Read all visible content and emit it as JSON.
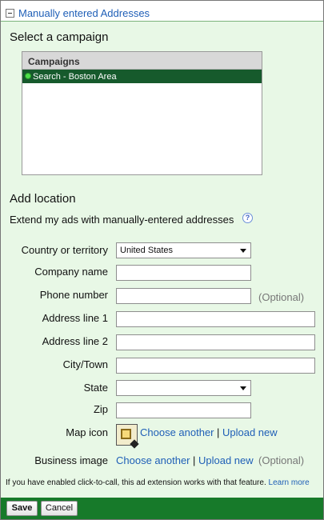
{
  "header": {
    "title": "Manually entered Addresses"
  },
  "campaign_section": {
    "heading": "Select a campaign",
    "list_header": "Campaigns",
    "items": [
      {
        "label": "Search - Boston Area",
        "status_color": "#4ee04a",
        "selected": true
      }
    ]
  },
  "location_section": {
    "heading": "Add location",
    "subtitle": "Extend my ads with manually-entered addresses",
    "help_glyph": "?"
  },
  "form": {
    "country": {
      "label": "Country or territory",
      "value": "United States"
    },
    "company_name": {
      "label": "Company name",
      "value": ""
    },
    "phone_number": {
      "label": "Phone number",
      "value": "",
      "note": "(Optional)"
    },
    "address_line_1": {
      "label": "Address line 1",
      "value": ""
    },
    "address_line_2": {
      "label": "Address line 2",
      "value": ""
    },
    "city": {
      "label": "City/Town",
      "value": ""
    },
    "state": {
      "label": "State",
      "value": ""
    },
    "zip": {
      "label": "Zip",
      "value": ""
    },
    "map_icon": {
      "label": "Map icon",
      "choose_link": "Choose another",
      "separator": "|",
      "upload_link": "Upload new"
    },
    "business_image": {
      "label": "Business image",
      "choose_link": "Choose another",
      "separator": "|",
      "upload_link": "Upload new",
      "note": "(Optional)"
    }
  },
  "footnote": {
    "text": "If you have enabled click-to-call, this ad extension works with that feature.",
    "link": "Learn more"
  },
  "actions": {
    "save_label": "Save",
    "cancel_label": "Cancel"
  },
  "colors": {
    "bar_green": "#177a2a",
    "selected_row": "#165a2c",
    "panel_bg": "#e8f8e6",
    "link_blue": "#1f5fb7"
  }
}
